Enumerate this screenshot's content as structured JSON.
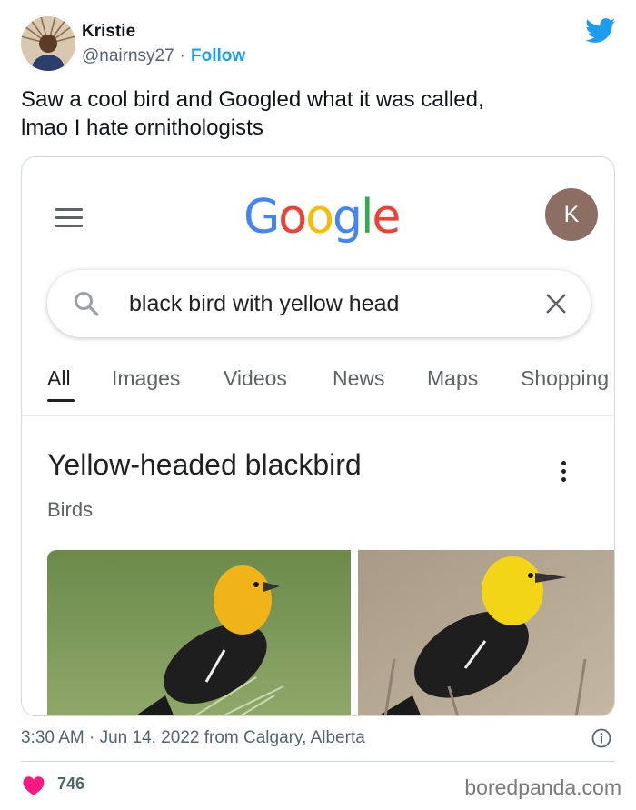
{
  "tweet": {
    "author_name": "Kristie",
    "handle": "@nairnsy27",
    "separator": "·",
    "follow_label": "Follow",
    "text_line1": "Saw a cool bird and Googled what it was called,",
    "text_line2": "lmao I hate ornithologists",
    "timestamp": "3:30 AM · Jun 14, 2022 from Calgary, Alberta",
    "likes": "746",
    "icons": [
      "twitter-bird-icon",
      "info-icon",
      "heart-icon"
    ],
    "brand_color": "#1d9bf0",
    "like_color": "#f91880"
  },
  "google": {
    "logo_letters": [
      "G",
      "o",
      "o",
      "g",
      "l",
      "e"
    ],
    "account_initial": "K",
    "search_query": "black bird with yellow head",
    "tabs": [
      "All",
      "Images",
      "Videos",
      "News",
      "Maps",
      "Shopping"
    ],
    "active_tab": "All",
    "result_title": "Yellow-headed blackbird",
    "result_subtitle": "Birds",
    "icons": [
      "menu-icon",
      "search-icon",
      "clear-icon",
      "more-vert-icon"
    ]
  },
  "watermark": "boredpanda.com"
}
